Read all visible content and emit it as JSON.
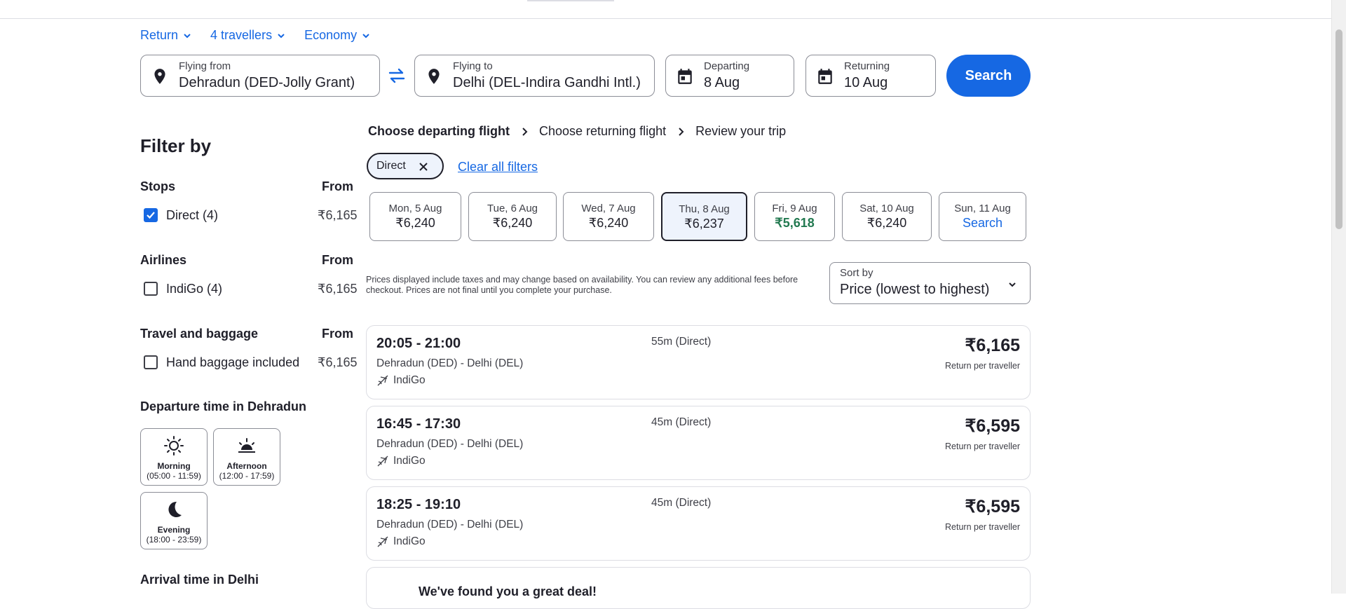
{
  "trip_options": {
    "trip_type": "Return",
    "travellers": "4 travellers",
    "cabin": "Economy"
  },
  "search": {
    "from_label": "Flying from",
    "from_value": "Dehradun (DED-Jolly Grant)",
    "to_label": "Flying to",
    "to_value": "Delhi (DEL-Indira Gandhi Intl.)",
    "depart_label": "Departing",
    "depart_value": "8 Aug",
    "return_label": "Returning",
    "return_value": "10 Aug",
    "button": "Search"
  },
  "filters": {
    "title": "Filter by",
    "stops": {
      "title": "Stops",
      "from": "From",
      "option": "Direct (4)",
      "price": "₹6,165",
      "checked": true
    },
    "airlines": {
      "title": "Airlines",
      "from": "From",
      "option": "IndiGo (4)",
      "price": "₹6,165",
      "checked": false
    },
    "baggage": {
      "title": "Travel and baggage",
      "from": "From",
      "option": "Hand baggage included",
      "price": "₹6,165",
      "checked": false
    },
    "departure_time": {
      "title": "Departure time in Dehradun",
      "slots": [
        {
          "label": "Morning",
          "range": "(05:00 - 11:59)",
          "icon": "sun-icon"
        },
        {
          "label": "Afternoon",
          "range": "(12:00 - 17:59)",
          "icon": "sunset-icon"
        },
        {
          "label": "Evening",
          "range": "(18:00 - 23:59)",
          "icon": "moon-icon"
        }
      ]
    },
    "arrival_title": "Arrival time in Delhi"
  },
  "steps": [
    "Choose departing flight",
    "Choose returning flight",
    "Review your trip"
  ],
  "active_filter_chip": "Direct",
  "clear_filters": "Clear all filters",
  "dates": [
    {
      "day": "Mon, 5 Aug",
      "price": "₹6,240"
    },
    {
      "day": "Tue, 6 Aug",
      "price": "₹6,240"
    },
    {
      "day": "Wed, 7 Aug",
      "price": "₹6,240"
    },
    {
      "day": "Thu, 8 Aug",
      "price": "₹6,237",
      "selected": true
    },
    {
      "day": "Fri, 9 Aug",
      "price": "₹5,618",
      "cheapest": true
    },
    {
      "day": "Sat, 10 Aug",
      "price": "₹6,240"
    },
    {
      "day": "Sun, 11 Aug",
      "price": "Search"
    }
  ],
  "price_note": "Prices displayed include taxes and may change based on availability. You can review any additional fees before checkout. Prices are not final until you complete your purchase.",
  "sort": {
    "label": "Sort by",
    "value": "Price (lowest to highest)"
  },
  "flights": [
    {
      "times": "20:05 - 21:00",
      "route": "Dehradun (DED) - Delhi (DEL)",
      "airline": "IndiGo",
      "duration": "55m (Direct)",
      "price": "₹6,165",
      "price_note": "Return per traveller"
    },
    {
      "times": "16:45 - 17:30",
      "route": "Dehradun (DED) - Delhi (DEL)",
      "airline": "IndiGo",
      "duration": "45m (Direct)",
      "price": "₹6,595",
      "price_note": "Return per traveller"
    },
    {
      "times": "18:25 - 19:10",
      "route": "Dehradun (DED) - Delhi (DEL)",
      "airline": "IndiGo",
      "duration": "45m (Direct)",
      "price": "₹6,595",
      "price_note": "Return per traveller"
    }
  ],
  "deal_banner": "We've found you a great deal!",
  "colors": {
    "accent": "#1668e3",
    "text": "#1f1f29",
    "cheapest": "#227950",
    "selected_bg": "#eef3fc"
  }
}
